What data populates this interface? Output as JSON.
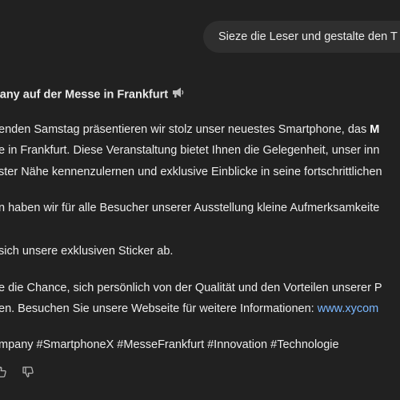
{
  "user_message": {
    "text": "Sieze die Leser und gestalte den T"
  },
  "assistant_message": {
    "heading": "mpany auf der Messe in Frankfurt",
    "paragraph1": {
      "line1_prefix": "enden Samstag präsentieren wir stolz unser neuestes Smartphone, das ",
      "line1_bold": "M",
      "line2": "e in Frankfurt. Diese Veranstaltung bietet Ihnen die Gelegenheit, unser inn",
      "line3": "ster Nähe kennenzulernen und exklusive Einblicke in seine fortschrittlichen"
    },
    "paragraph2": {
      "line1": "n haben wir für alle Besucher unserer Ausstellung kleine Aufmerksamkeite",
      "line2": "sich unsere exklusiven Sticker ab."
    },
    "paragraph3": {
      "line1": "e die Chance, sich persönlich von der Qualität und den Vorteilen unserer P",
      "line2_prefix": "en. Besuchen Sie unsere Webseite für weitere Informationen: ",
      "line2_link": "www.xycom"
    },
    "hashtags": "mpany #SmartphoneX #MesseFrankfurt #Innovation #Technologie"
  },
  "icons": {
    "heading_icon": "megaphone-icon",
    "action_1": "thumbs-up-icon",
    "action_2": "thumbs-down-icon"
  },
  "colors": {
    "background": "#212121",
    "user_bubble": "#2f2f2f",
    "text": "#ececec",
    "link": "#7ab7ff"
  }
}
